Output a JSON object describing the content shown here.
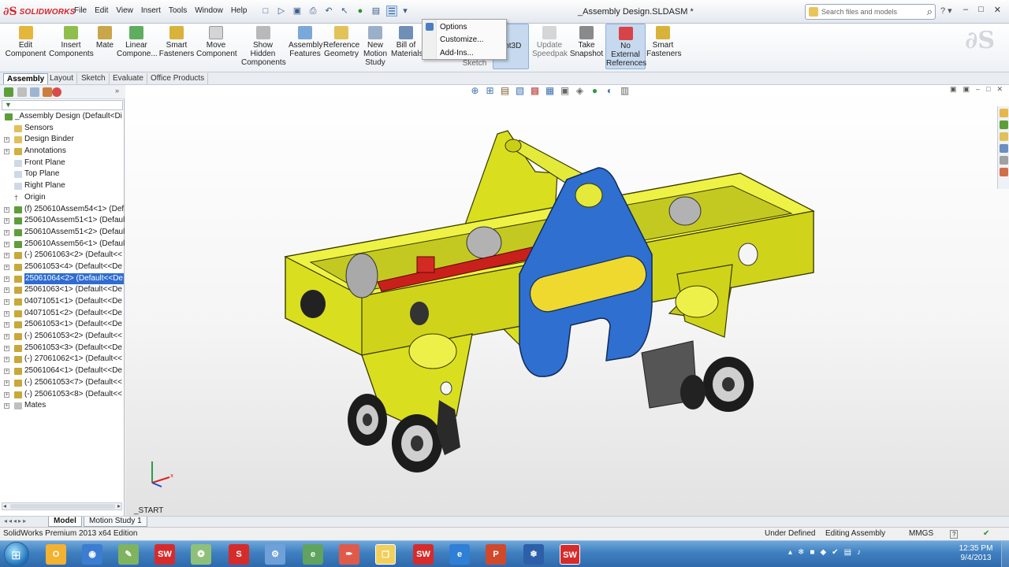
{
  "app": {
    "logo_text": "SOLIDWORKS",
    "document_title": "_Assembly Design.SLDASM *",
    "menu": [
      "File",
      "Edit",
      "View",
      "Insert",
      "Tools",
      "Window",
      "Help"
    ],
    "search_placeholder": "Search files and models"
  },
  "command_manager": {
    "buttons": [
      {
        "label": "Edit\nComponent",
        "icon": "edit-component-icon"
      },
      {
        "label": "Insert\nComponents",
        "icon": "insert-components-icon"
      },
      {
        "label": "Mate",
        "icon": "mate-icon"
      },
      {
        "label": "Linear\nCompone...",
        "icon": "linear-pattern-icon"
      },
      {
        "label": "Smart\nFasteners",
        "icon": "smart-fasteners-icon"
      },
      {
        "label": "Move\nComponent",
        "icon": "move-component-icon"
      },
      {
        "label": "Show\nHidden\nComponents",
        "icon": "show-hidden-icon"
      },
      {
        "label": "Assembly\nFeatures",
        "icon": "assembly-features-icon"
      },
      {
        "label": "Reference\nGeometry",
        "icon": "reference-geometry-icon"
      },
      {
        "label": "New\nMotion\nStudy",
        "icon": "motion-study-icon"
      },
      {
        "label": "Bill of\nMaterials",
        "icon": "bom-icon"
      },
      {
        "label": "Sketch",
        "icon": "sketch-icon"
      },
      {
        "label": "ant3D",
        "icon": "instant3d-icon"
      },
      {
        "label": "Update\nSpeedpak",
        "icon": "speedpak-icon"
      },
      {
        "label": "Take\nSnapshot",
        "icon": "snapshot-icon"
      },
      {
        "label": "No\nExternal\nReferences",
        "icon": "no-external-refs-icon"
      },
      {
        "label": "Smart\nFasteners",
        "icon": "smart-fasteners-2-icon"
      }
    ]
  },
  "options_dropdown": {
    "items": [
      "Options",
      "Customize...",
      "Add-Ins..."
    ]
  },
  "tabs": [
    "Assembly",
    "Layout",
    "Sketch",
    "Evaluate",
    "Office Products"
  ],
  "feature_tree": {
    "items": [
      {
        "label": "_Assembly Design  (Default<Di",
        "icon": "assembly-icon",
        "expand": false,
        "indent": 0
      },
      {
        "label": "Sensors",
        "icon": "sensors-icon",
        "expand": false,
        "indent": 1
      },
      {
        "label": "Design Binder",
        "icon": "design-binder-icon",
        "expand": true,
        "indent": 1
      },
      {
        "label": "Annotations",
        "icon": "annotations-icon",
        "expand": true,
        "indent": 1
      },
      {
        "label": "Front Plane",
        "icon": "plane-icon",
        "expand": false,
        "indent": 1
      },
      {
        "label": "Top Plane",
        "icon": "plane-icon",
        "expand": false,
        "indent": 1
      },
      {
        "label": "Right Plane",
        "icon": "plane-icon",
        "expand": false,
        "indent": 1
      },
      {
        "label": "Origin",
        "icon": "origin-icon",
        "expand": false,
        "indent": 1
      },
      {
        "label": "(f) 250610Assem54<1> (Def",
        "icon": "subassembly-icon",
        "expand": true,
        "indent": 1
      },
      {
        "label": "250610Assem51<1> (Defaul",
        "icon": "subassembly-icon",
        "expand": true,
        "indent": 1
      },
      {
        "label": "250610Assem51<2> (Defaul",
        "icon": "subassembly-icon",
        "expand": true,
        "indent": 1
      },
      {
        "label": "250610Assem56<1> (Defaul",
        "icon": "subassembly-icon",
        "expand": true,
        "indent": 1
      },
      {
        "label": "(-) 25061063<2> (Default<<",
        "icon": "part-icon",
        "expand": true,
        "indent": 1
      },
      {
        "label": "25061053<4> (Default<<De",
        "icon": "part-icon",
        "expand": true,
        "indent": 1
      },
      {
        "label": "25061064<2> (Default<<De",
        "icon": "part-icon",
        "expand": true,
        "indent": 1,
        "selected": true
      },
      {
        "label": "25061063<1> (Default<<De",
        "icon": "part-icon",
        "expand": true,
        "indent": 1
      },
      {
        "label": "04071051<1> (Default<<De",
        "icon": "part-icon",
        "expand": true,
        "indent": 1
      },
      {
        "label": "04071051<2> (Default<<De",
        "icon": "part-icon",
        "expand": true,
        "indent": 1
      },
      {
        "label": "25061053<1> (Default<<De",
        "icon": "part-icon",
        "expand": true,
        "indent": 1
      },
      {
        "label": "(-) 25061053<2> (Default<<",
        "icon": "part-icon",
        "expand": true,
        "indent": 1
      },
      {
        "label": "25061053<3> (Default<<De",
        "icon": "part-icon",
        "expand": true,
        "indent": 1
      },
      {
        "label": "(-) 27061062<1> (Default<<",
        "icon": "part-icon",
        "expand": true,
        "indent": 1
      },
      {
        "label": "25061064<1> (Default<<De",
        "icon": "part-icon",
        "expand": true,
        "indent": 1
      },
      {
        "label": "(-) 25061053<7> (Default<<",
        "icon": "part-icon",
        "expand": true,
        "indent": 1
      },
      {
        "label": "(-) 25061053<8> (Default<<",
        "icon": "part-icon",
        "expand": true,
        "indent": 1
      },
      {
        "label": "Mates",
        "icon": "mates-icon",
        "expand": true,
        "indent": 1
      }
    ]
  },
  "graphics": {
    "start_label": "_START",
    "colors": {
      "frame": "#d9df1f",
      "plate": "#2f6fd0",
      "rod": "#c9201c",
      "wheel": "#1c1c1c"
    }
  },
  "bottom_tabs": [
    "Model",
    "Motion Study 1"
  ],
  "status": {
    "left": "SolidWorks Premium 2013 x64 Edition",
    "state": "Under Defined",
    "mode": "Editing Assembly",
    "units": "MMGS",
    "help_icon": "?"
  },
  "taskbar": {
    "time": "12:35 PM",
    "date": "9/4/2013"
  }
}
